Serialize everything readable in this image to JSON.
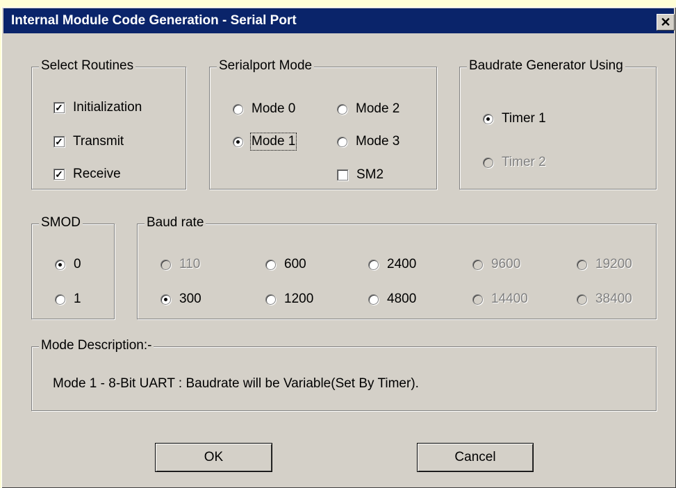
{
  "window": {
    "title": "Internal Module Code Generation - Serial Port",
    "close_glyph": "✕",
    "close_icon": "close-icon",
    "titlebar_color": "#0a246a",
    "face_color": "#d4d0c8",
    "backdrop_color": "#fffed6"
  },
  "select_routines": {
    "legend": "Select Routines",
    "items": [
      {
        "label": "Initialization",
        "checked": true
      },
      {
        "label": "Transmit",
        "checked": true
      },
      {
        "label": "Receive",
        "checked": true
      }
    ]
  },
  "serialport_mode": {
    "legend": "Serialport Mode",
    "options": [
      {
        "label": "Mode 0",
        "selected": false
      },
      {
        "label": "Mode 2",
        "selected": false
      },
      {
        "label": "Mode 1",
        "selected": true
      },
      {
        "label": "Mode 3",
        "selected": false
      }
    ],
    "sm2": {
      "label": "SM2",
      "checked": false
    }
  },
  "baudrate_generator": {
    "legend": "Baudrate Generator Using",
    "options": [
      {
        "label": "Timer 1",
        "selected": true,
        "enabled": true
      },
      {
        "label": "Timer 2",
        "selected": false,
        "enabled": false
      }
    ]
  },
  "smod": {
    "legend": "SMOD",
    "options": [
      {
        "label": "0",
        "selected": true
      },
      {
        "label": "1",
        "selected": false
      }
    ]
  },
  "baud_rate": {
    "legend": "Baud rate",
    "options": [
      {
        "label": "110",
        "selected": false,
        "enabled": false
      },
      {
        "label": "300",
        "selected": true,
        "enabled": true
      },
      {
        "label": "600",
        "selected": false,
        "enabled": true
      },
      {
        "label": "1200",
        "selected": false,
        "enabled": true
      },
      {
        "label": "2400",
        "selected": false,
        "enabled": true
      },
      {
        "label": "4800",
        "selected": false,
        "enabled": true
      },
      {
        "label": "9600",
        "selected": false,
        "enabled": false
      },
      {
        "label": "14400",
        "selected": false,
        "enabled": false
      },
      {
        "label": "19200",
        "selected": false,
        "enabled": false
      },
      {
        "label": "38400",
        "selected": false,
        "enabled": false
      }
    ]
  },
  "mode_description": {
    "legend": "Mode Description:-",
    "text": "Mode 1 - 8-Bit UART : Baudrate will be Variable(Set By Timer)."
  },
  "buttons": {
    "ok_label": "OK",
    "cancel_label": "Cancel"
  }
}
